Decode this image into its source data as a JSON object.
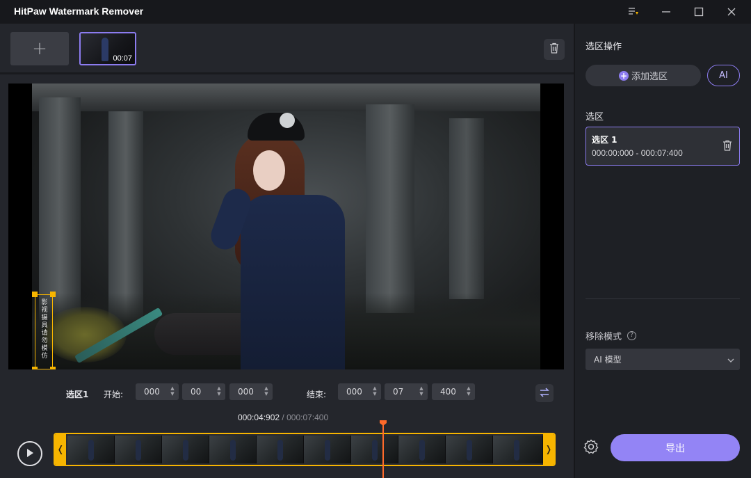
{
  "window": {
    "title": "HitPaw Watermark Remover",
    "icons": [
      "feedback-icon",
      "minimize-icon",
      "maximize-icon",
      "close-icon"
    ]
  },
  "media_bar": {
    "add_label": "+",
    "thumbnail_duration": "00:07"
  },
  "watermark_text": "影视摄具请勿模仿",
  "time_controls": {
    "region_label": "选区1",
    "start_label": "开始:",
    "start_values": [
      "000",
      "00",
      "000"
    ],
    "end_label": "结束:",
    "end_values": [
      "000",
      "07",
      "400"
    ]
  },
  "timeline": {
    "current_time": "000:04:902",
    "separator": "/",
    "total_time": "000:07:400",
    "playhead_fraction": 0.6626
  },
  "right_panel": {
    "region_ops_heading": "选区操作",
    "add_region_label": "添加选区",
    "ai_label": "AI",
    "regions_heading": "选区",
    "regions": [
      {
        "name": "选区 1",
        "range": "000:00:000 - 000:07:400"
      }
    ],
    "mode_heading": "移除模式",
    "mode_value": "AI 模型",
    "export_label": "导出"
  },
  "colors": {
    "accent": "#9384f5",
    "selection": "#f7b500",
    "playhead": "#ff6a2a"
  }
}
